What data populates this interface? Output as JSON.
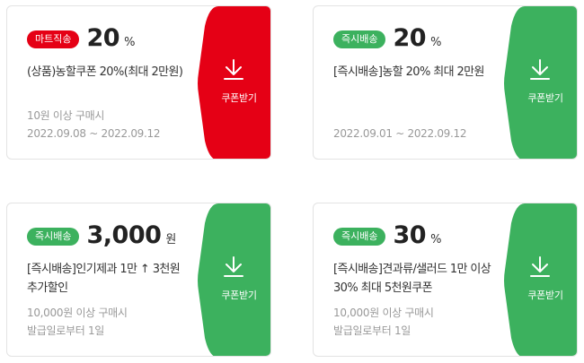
{
  "colors": {
    "red": "#e50015",
    "green": "#3cb15e"
  },
  "coupons": [
    {
      "badge": "마트직송",
      "badge_color": "#e50015",
      "tab_color": "#e50015",
      "amount": "20",
      "unit": "%",
      "title": "(상품)농할쿠폰 20%(최대 2만원)",
      "condition": "10원 이상 구매시",
      "period": "2022.09.08 ~ 2022.09.12",
      "download_label": "쿠폰받기",
      "download_icon": "download-icon"
    },
    {
      "badge": "즉시배송",
      "badge_color": "#3cb15e",
      "tab_color": "#3cb15e",
      "amount": "20",
      "unit": "%",
      "title": "[즉시배송]농할 20% 최대 2만원",
      "condition": "",
      "period": "2022.09.01 ~ 2022.09.12",
      "download_label": "쿠폰받기",
      "download_icon": "download-icon"
    },
    {
      "badge": "즉시배송",
      "badge_color": "#3cb15e",
      "tab_color": "#3cb15e",
      "amount": "3,000",
      "unit": "원",
      "title": "[즉시배송]인기제과 1만 ↑ 3천원 추가할인",
      "condition": "10,000원 이상 구매시",
      "period": "발급일로부터 1일",
      "download_label": "쿠폰받기",
      "download_icon": "download-icon"
    },
    {
      "badge": "즉시배송",
      "badge_color": "#3cb15e",
      "tab_color": "#3cb15e",
      "amount": "30",
      "unit": "%",
      "title": "[즉시배송]견과류/샐러드 1만 이상 30% 최대 5천원쿠폰",
      "condition": "10,000원 이상 구매시",
      "period": "발급일로부터 1일",
      "download_label": "쿠폰받기",
      "download_icon": "download-icon"
    }
  ]
}
